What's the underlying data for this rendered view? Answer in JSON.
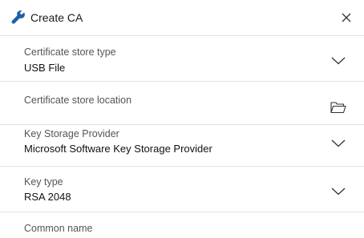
{
  "dialog": {
    "title": "Create CA",
    "title_icon": "wrench-icon",
    "close_icon": "close-icon"
  },
  "fields": {
    "store_type": {
      "label": "Certificate store type",
      "value": "USB File",
      "action_icon": "chevron-down-icon"
    },
    "store_location": {
      "label": "Certificate store location",
      "value": "",
      "action_icon": "folder-icon"
    },
    "key_storage_provider": {
      "label": "Key Storage Provider",
      "value": "Microsoft Software Key Storage Provider",
      "action_icon": "chevron-down-icon"
    },
    "key_type": {
      "label": "Key type",
      "value": "RSA 2048",
      "action_icon": "chevron-down-icon"
    },
    "common_name": {
      "label": "Common name",
      "value": ""
    }
  },
  "colors": {
    "accent": "#1f5fa8",
    "divider": "#e3e3e3",
    "label": "#555555"
  }
}
